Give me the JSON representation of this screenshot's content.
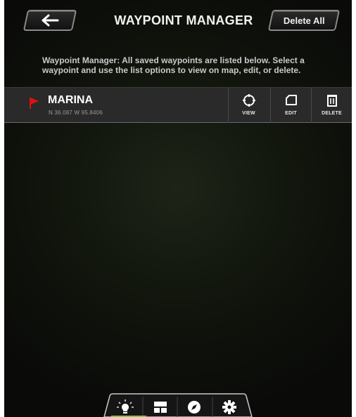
{
  "header": {
    "back_icon": "left-arrow-icon",
    "title": "WAYPOINT MANAGER",
    "delete_all_label": "Delete All"
  },
  "instructions": "Waypoint Manager: All saved waypoints are listed below.  Select a waypoint and use the list options to view on map, edit, or delete.",
  "waypoints": [
    {
      "name": "MARINA",
      "coords": "N 36.087 W 95.8406",
      "flag_color": "#e01010",
      "actions": {
        "view": "VIEW",
        "edit": "EDIT",
        "delete": "DELETE"
      }
    }
  ],
  "tabbar": {
    "tabs": [
      {
        "icon": "lightbulb-icon"
      },
      {
        "icon": "layout-panels-icon"
      },
      {
        "icon": "compass-icon"
      },
      {
        "icon": "gear-icon",
        "active": true
      }
    ],
    "active_color": "#8bc34a"
  }
}
